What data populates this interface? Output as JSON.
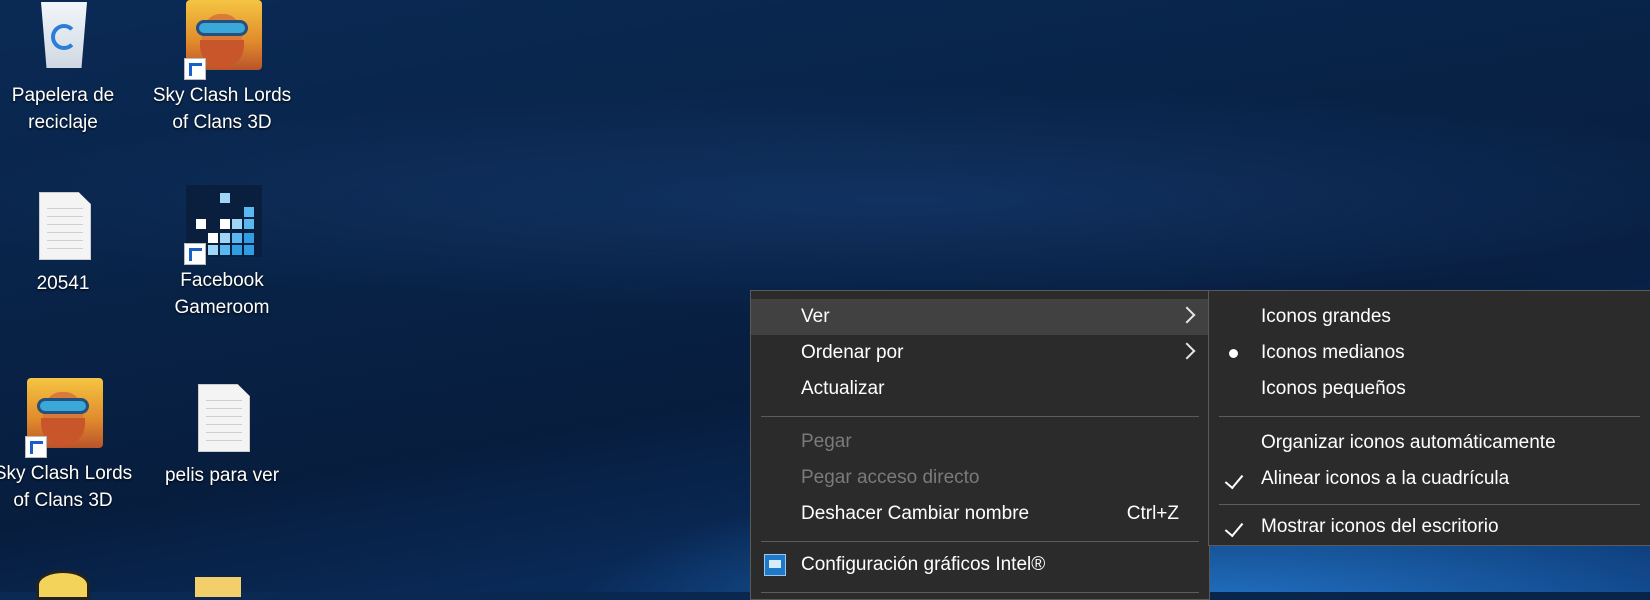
{
  "desktop_icons": [
    {
      "label_line1": "Papelera de",
      "label_line2": "reciclaje",
      "icon": "recycle-bin-icon"
    },
    {
      "label_line1": "Sky Clash Lords",
      "label_line2": "of Clans 3D",
      "icon": "game-icon"
    },
    {
      "label_line1": "20541",
      "label_line2": "",
      "icon": "text-file-icon"
    },
    {
      "label_line1": "Facebook",
      "label_line2": "Gameroom",
      "icon": "gameroom-icon"
    },
    {
      "label_line1": "Sky Clash Lords",
      "label_line2": "of Clans 3D",
      "icon": "game-icon"
    },
    {
      "label_line1": "pelis para ver",
      "label_line2": "",
      "icon": "text-file-icon"
    }
  ],
  "context_menu": {
    "items": [
      {
        "label": "Ver",
        "submenu": true
      },
      {
        "label": "Ordenar por",
        "submenu": true
      },
      {
        "label": "Actualizar"
      },
      {
        "label": "Pegar",
        "disabled": true
      },
      {
        "label": "Pegar acceso directo",
        "disabled": true
      },
      {
        "label": "Deshacer Cambiar nombre",
        "accelerator": "Ctrl+Z"
      },
      {
        "label": "Configuración gráficos Intel®",
        "icon": "intel-graphics-icon"
      }
    ]
  },
  "view_submenu": {
    "items": [
      {
        "label": "Iconos grandes"
      },
      {
        "label": "Iconos medianos",
        "selected": true
      },
      {
        "label": "Iconos pequeños"
      },
      {
        "label": "Organizar iconos automáticamente"
      },
      {
        "label": "Alinear iconos a la cuadrícula",
        "checked": true
      },
      {
        "label": "Mostrar iconos del escritorio",
        "checked": true
      }
    ]
  },
  "colors": {
    "menu_bg": "#2b2b2b",
    "menu_hover": "#414141",
    "disabled_text": "#7a7a7a",
    "desktop_bg": "#082347"
  }
}
